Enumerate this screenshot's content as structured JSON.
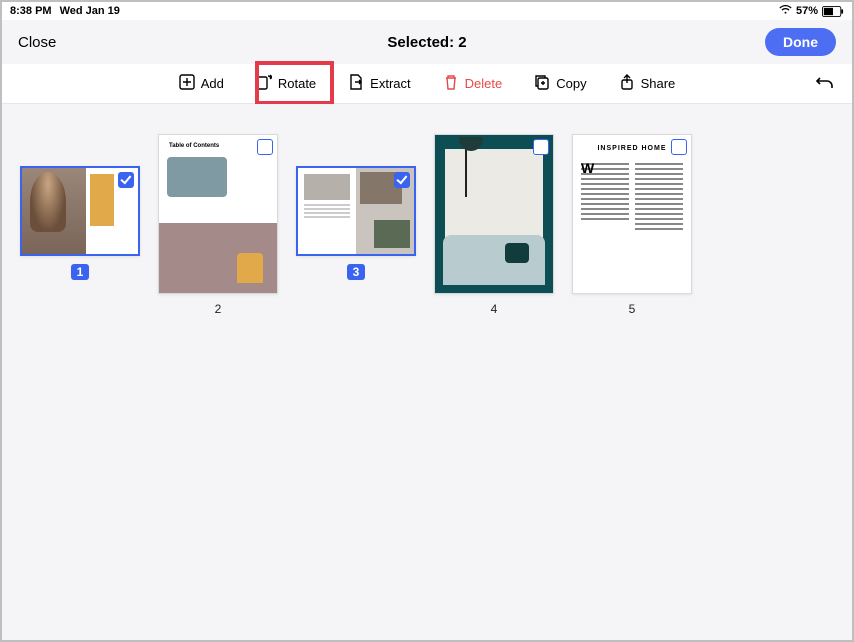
{
  "status": {
    "time": "8:38 PM",
    "date": "Wed Jan 19",
    "battery_pct": "57%"
  },
  "header": {
    "close": "Close",
    "title": "Selected: 2",
    "done": "Done"
  },
  "toolbar": {
    "add": "Add",
    "rotate": "Rotate",
    "extract": "Extract",
    "delete": "Delete",
    "copy": "Copy",
    "share": "Share"
  },
  "highlight": {
    "target": "rotate"
  },
  "pages": [
    {
      "num": "1",
      "selected": true,
      "orientation": "landscape"
    },
    {
      "num": "2",
      "selected": false,
      "orientation": "portrait",
      "toc_label": "Table of Contents"
    },
    {
      "num": "3",
      "selected": true,
      "orientation": "landscape"
    },
    {
      "num": "4",
      "selected": false,
      "orientation": "portrait"
    },
    {
      "num": "5",
      "selected": false,
      "orientation": "portrait",
      "doc_title": "INSPIRED HOME"
    }
  ]
}
